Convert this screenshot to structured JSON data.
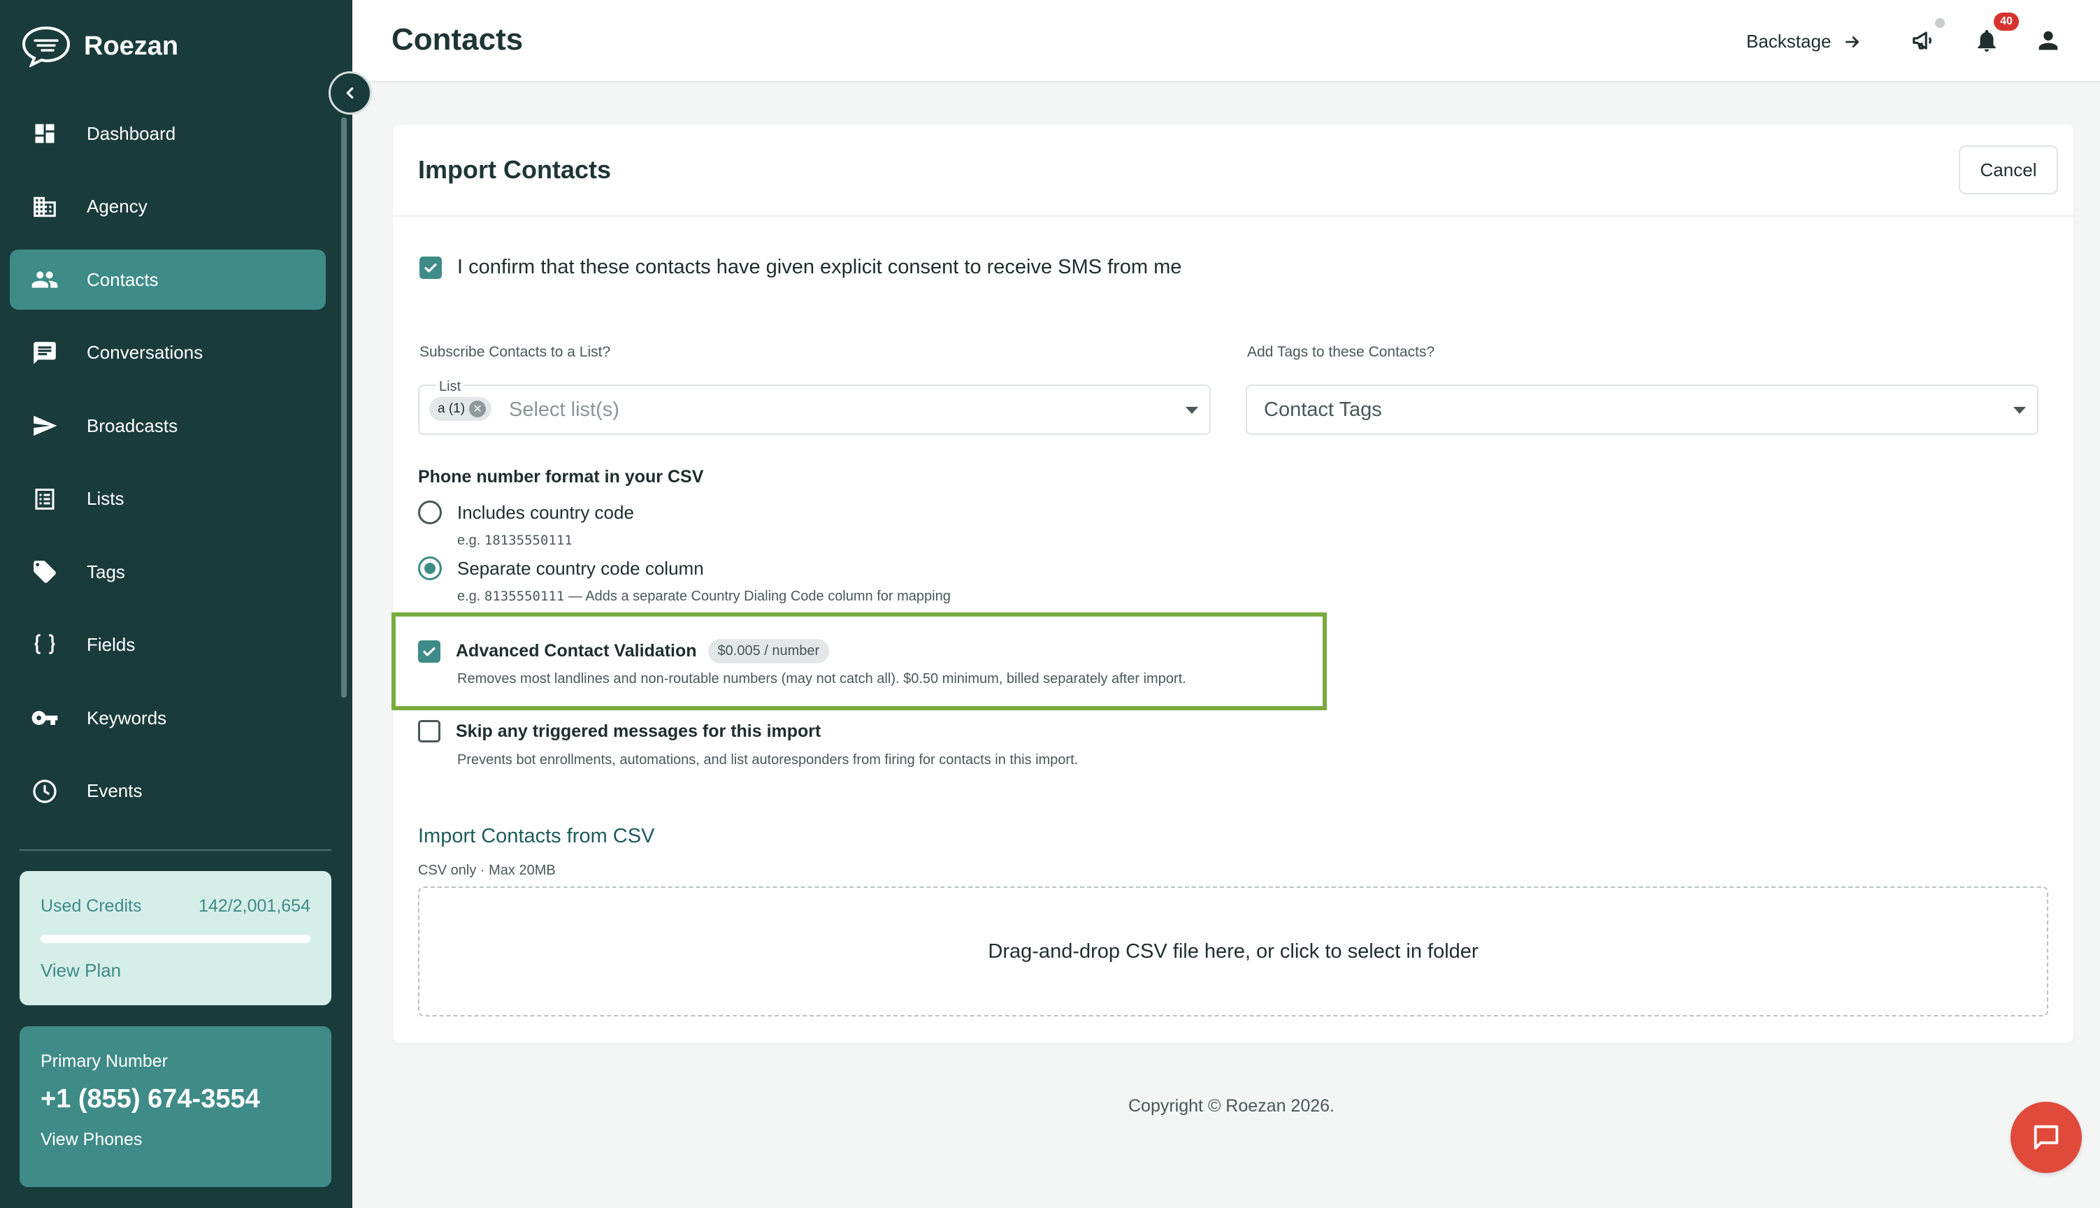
{
  "app": {
    "name": "Roezan",
    "logo_icon": "chat-bubble-icon"
  },
  "sidebar": {
    "items": [
      {
        "label": "Dashboard",
        "icon": "dashboard-icon"
      },
      {
        "label": "Agency",
        "icon": "building-icon"
      },
      {
        "label": "Contacts",
        "icon": "people-icon",
        "active": true
      },
      {
        "label": "Conversations",
        "icon": "message-icon"
      },
      {
        "label": "Broadcasts",
        "icon": "send-icon"
      },
      {
        "label": "Lists",
        "icon": "list-icon"
      },
      {
        "label": "Tags",
        "icon": "tag-icon"
      },
      {
        "label": "Fields",
        "icon": "braces-icon"
      },
      {
        "label": "Keywords",
        "icon": "key-icon"
      },
      {
        "label": "Events",
        "icon": "clock-icon"
      }
    ],
    "credits": {
      "label": "Used Credits",
      "value": "142/2,001,654",
      "fraction": 7e-05,
      "link": "View Plan"
    },
    "phone": {
      "label": "Primary Number",
      "number": "+1 (855) 674-3554",
      "link": "View Phones"
    }
  },
  "header": {
    "title": "Contacts",
    "backstage": "Backstage",
    "notifications_count": "40"
  },
  "import": {
    "title": "Import Contacts",
    "cancel": "Cancel",
    "consent": {
      "text": "I confirm that these contacts have given explicit consent to receive SMS from me",
      "checked": true
    },
    "list": {
      "label": "Subscribe Contacts to a List?",
      "float_label": "List",
      "chip": "a (1)",
      "placeholder": "Select list(s)"
    },
    "tags": {
      "label": "Add Tags to these Contacts?",
      "value": "Contact Tags"
    },
    "phone_format": {
      "heading": "Phone number format in your CSV",
      "options": [
        {
          "label": "Includes country code",
          "hint_code": "18135550111",
          "hint_prefix": "e.g. ",
          "hint_suffix": "",
          "selected": false
        },
        {
          "label": "Separate country code column",
          "hint_code": "8135550111",
          "hint_prefix": "e.g. ",
          "hint_suffix": " — Adds a separate Country Dialing Code column for mapping",
          "selected": true
        }
      ]
    },
    "validation": {
      "title": "Advanced Contact Validation",
      "price": "$0.005 / number",
      "desc": "Removes most landlines and non-routable numbers (may not catch all). $0.50 minimum, billed separately after import.",
      "checked": true
    },
    "skip": {
      "title": "Skip any triggered messages for this import",
      "desc": "Prevents bot enrollments, automations, and list autoresponders from firing for contacts in this import.",
      "checked": false
    },
    "csv": {
      "heading": "Import Contacts from CSV",
      "sub": "CSV only · Max 20MB",
      "drop_text": "Drag-and-drop CSV file here, or click to select in folder"
    }
  },
  "footer": {
    "copyright": "Copyright © Roezan 2026."
  },
  "colors": {
    "sidebar": "#1a3b3b",
    "accent": "#3e8b87",
    "highlight": "#7aab3f",
    "badge": "#d8322f",
    "chat": "#e04a3b"
  }
}
